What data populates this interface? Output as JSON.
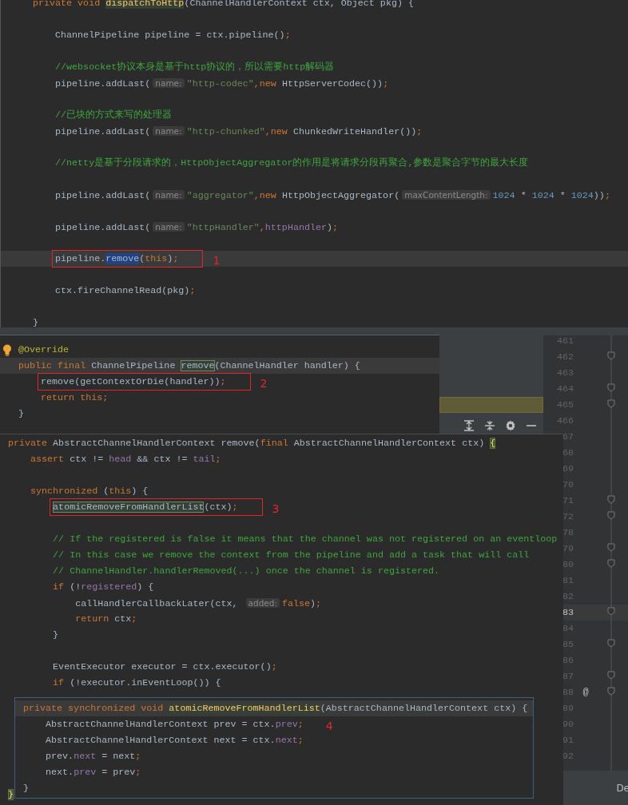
{
  "editors": [
    {
      "kind": "main",
      "lines": [
        {
          "kind": "code",
          "current": false,
          "tokens": [
            {
              "kind": "kw",
              "text": "private void "
            },
            {
              "kind": "decl",
              "text": "dispatchToHttp"
            },
            {
              "kind": "plain",
              "text": "(ChannelHandlerContext ctx, Object pkg) {"
            }
          ]
        },
        {
          "kind": "blank",
          "current": false
        },
        {
          "kind": "code",
          "current": false,
          "tokens": [
            {
              "kind": "plain",
              "text": "    ChannelPipeline pipeline = ctx.pipeline()"
            },
            {
              "kind": "kw",
              "text": ";"
            }
          ]
        },
        {
          "kind": "blank",
          "current": false
        },
        {
          "kind": "code",
          "current": false,
          "tokens": [
            {
              "kind": "comment",
              "text": "    //websocket协议本身是基于http协议的，所以需要http解码器"
            }
          ]
        },
        {
          "kind": "code",
          "current": false,
          "tokens": [
            {
              "kind": "plain",
              "text": "    pipeline.addLast("
            },
            {
              "kind": "hint",
              "text": "name:"
            },
            {
              "kind": "str",
              "text": "\"http-codec\""
            },
            {
              "kind": "kw",
              "text": ",new "
            },
            {
              "kind": "plain",
              "text": "HttpServerCodec())"
            },
            {
              "kind": "kw",
              "text": ";"
            }
          ]
        },
        {
          "kind": "blank",
          "current": false
        },
        {
          "kind": "code",
          "current": false,
          "tokens": [
            {
              "kind": "comment",
              "text": "    //已块的方式来写的处理器"
            }
          ]
        },
        {
          "kind": "code",
          "current": false,
          "tokens": [
            {
              "kind": "plain",
              "text": "    pipeline.addLast("
            },
            {
              "kind": "hint",
              "text": "name:"
            },
            {
              "kind": "str",
              "text": "\"http-chunked\""
            },
            {
              "kind": "kw",
              "text": ",new "
            },
            {
              "kind": "plain",
              "text": "ChunkedWriteHandler())"
            },
            {
              "kind": "kw",
              "text": ";"
            }
          ]
        },
        {
          "kind": "blank",
          "current": false
        },
        {
          "kind": "code",
          "current": false,
          "tokens": [
            {
              "kind": "comment",
              "text": "    //netty是基于分段请求的，HttpObjectAggregator的作用是将请求分段再聚合,参数是聚合字节的最大长度"
            }
          ]
        },
        {
          "kind": "blank",
          "current": false
        },
        {
          "kind": "code",
          "current": false,
          "tokens": [
            {
              "kind": "plain",
              "text": "    pipeline.addLast("
            },
            {
              "kind": "hint",
              "text": "name:"
            },
            {
              "kind": "str",
              "text": "\"aggregator\""
            },
            {
              "kind": "kw",
              "text": ",new "
            },
            {
              "kind": "plain",
              "text": "HttpObjectAggregator("
            },
            {
              "kind": "hint",
              "text": "maxContentLength:"
            },
            {
              "kind": "num",
              "text": "1024"
            },
            {
              "kind": "plain",
              "text": " * "
            },
            {
              "kind": "num",
              "text": "1024"
            },
            {
              "kind": "plain",
              "text": " * "
            },
            {
              "kind": "num",
              "text": "1024"
            },
            {
              "kind": "plain",
              "text": "))"
            },
            {
              "kind": "kw",
              "text": ";"
            }
          ]
        },
        {
          "kind": "blank",
          "current": false
        },
        {
          "kind": "code",
          "current": false,
          "tokens": [
            {
              "kind": "plain",
              "text": "    pipeline.addLast("
            },
            {
              "kind": "hint",
              "text": "name:"
            },
            {
              "kind": "str",
              "text": "\"httpHandler\""
            },
            {
              "kind": "kw",
              "text": ","
            },
            {
              "kind": "field",
              "text": "httpHandler"
            },
            {
              "kind": "plain",
              "text": ")"
            },
            {
              "kind": "kw",
              "text": ";"
            }
          ]
        },
        {
          "kind": "blank",
          "current": false
        },
        {
          "kind": "code",
          "current": true,
          "callout": {
            "label": "1",
            "boxed": true
          },
          "tokens": [
            {
              "kind": "plain",
              "text": "    pipeline."
            },
            {
              "kind": "selected",
              "text": "remove"
            },
            {
              "kind": "plain",
              "text": "("
            },
            {
              "kind": "kw",
              "text": "this"
            },
            {
              "kind": "plain",
              "text": ")"
            },
            {
              "kind": "kw",
              "text": ";"
            }
          ]
        },
        {
          "kind": "blank",
          "current": false
        },
        {
          "kind": "code",
          "current": false,
          "tokens": [
            {
              "kind": "plain",
              "text": "    ctx.fireChannelRead(pkg)"
            },
            {
              "kind": "kw",
              "text": ";"
            }
          ]
        },
        {
          "kind": "blank",
          "current": false
        },
        {
          "kind": "code",
          "current": false,
          "tokens": [
            {
              "kind": "plain",
              "text": "}"
            }
          ]
        }
      ]
    },
    {
      "kind": "popup",
      "lines": [
        {
          "kind": "code",
          "current": false,
          "tokens": [
            {
              "kind": "annotation",
              "text": "@Override"
            }
          ]
        },
        {
          "kind": "code",
          "current": true,
          "tokens": [
            {
              "kind": "kw",
              "text": "public final "
            },
            {
              "kind": "plain",
              "text": "ChannelPipeline "
            },
            {
              "kind": "usage",
              "text": "remove"
            },
            {
              "kind": "plain",
              "text": "(ChannelHandler handler) {"
            }
          ]
        },
        {
          "kind": "code",
          "current": false,
          "callout": {
            "label": "2",
            "boxed": true
          },
          "tokens": [
            {
              "kind": "plain",
              "text": "    remove(getContextOrDie(handler))"
            },
            {
              "kind": "kw",
              "text": ";"
            }
          ]
        },
        {
          "kind": "code",
          "current": false,
          "tokens": [
            {
              "kind": "kw",
              "text": "    return this;"
            }
          ]
        },
        {
          "kind": "code",
          "current": false,
          "tokens": [
            {
              "kind": "plain",
              "text": "}"
            }
          ]
        }
      ]
    },
    {
      "kind": "panel",
      "lines": [
        {
          "kind": "code",
          "current": false,
          "tokens": [
            {
              "kind": "kw",
              "text": "private "
            },
            {
              "kind": "plain",
              "text": "AbstractChannelHandlerContext remove("
            },
            {
              "kind": "kw",
              "text": "final "
            },
            {
              "kind": "plain",
              "text": "AbstractChannelHandlerContext ctx) "
            },
            {
              "kind": "brace",
              "text": "{"
            }
          ]
        },
        {
          "kind": "code",
          "current": false,
          "tokens": [
            {
              "kind": "kw",
              "text": "    assert "
            },
            {
              "kind": "plain",
              "text": "ctx != "
            },
            {
              "kind": "field",
              "text": "head"
            },
            {
              "kind": "plain",
              "text": " && ctx != "
            },
            {
              "kind": "field",
              "text": "tail"
            },
            {
              "kind": "kw",
              "text": ";"
            }
          ]
        },
        {
          "kind": "blank",
          "current": false
        },
        {
          "kind": "code",
          "current": false,
          "tokens": [
            {
              "kind": "kw",
              "text": "    synchronized "
            },
            {
              "kind": "plain",
              "text": "("
            },
            {
              "kind": "kw",
              "text": "this"
            },
            {
              "kind": "plain",
              "text": ") {"
            }
          ]
        },
        {
          "kind": "code",
          "current": false,
          "callout": {
            "label": "3",
            "boxed": true
          },
          "tokens": [
            {
              "kind": "usage",
              "text": "        atomicRemoveFromHandlerList"
            },
            {
              "kind": "plain",
              "text": "(ctx)"
            },
            {
              "kind": "kw",
              "text": ";"
            }
          ]
        },
        {
          "kind": "blank",
          "current": false
        },
        {
          "kind": "code",
          "current": false,
          "tokens": [
            {
              "kind": "comment",
              "text": "        // If the registered is false it means that the channel was not registered on an eventloop"
            }
          ]
        },
        {
          "kind": "code",
          "current": false,
          "tokens": [
            {
              "kind": "comment",
              "text": "        // In this case we remove the context from the pipeline and add a task that will call"
            }
          ]
        },
        {
          "kind": "code",
          "current": false,
          "tokens": [
            {
              "kind": "comment",
              "text": "        // ChannelHandler.handlerRemoved(...) once the channel is registered."
            }
          ]
        },
        {
          "kind": "code",
          "current": false,
          "tokens": [
            {
              "kind": "kw",
              "text": "        if "
            },
            {
              "kind": "plain",
              "text": "(!"
            },
            {
              "kind": "field",
              "text": "registered"
            },
            {
              "kind": "plain",
              "text": ") {"
            }
          ]
        },
        {
          "kind": "code",
          "current": false,
          "tokens": [
            {
              "kind": "plain",
              "text": "            callHandlerCallbackLater(ctx, "
            },
            {
              "kind": "hint",
              "text": "added:"
            },
            {
              "kind": "kw",
              "text": "false"
            },
            {
              "kind": "plain",
              "text": ")"
            },
            {
              "kind": "kw",
              "text": ";"
            }
          ]
        },
        {
          "kind": "code",
          "current": false,
          "tokens": [
            {
              "kind": "kw",
              "text": "            return "
            },
            {
              "kind": "plain",
              "text": "ctx"
            },
            {
              "kind": "kw",
              "text": ";"
            }
          ]
        },
        {
          "kind": "code",
          "current": false,
          "tokens": [
            {
              "kind": "plain",
              "text": "        }"
            }
          ]
        },
        {
          "kind": "blank",
          "current": false
        },
        {
          "kind": "code",
          "current": false,
          "tokens": [
            {
              "kind": "plain",
              "text": "        EventExecutor executor = ctx.executor()"
            },
            {
              "kind": "kw",
              "text": ";"
            }
          ]
        },
        {
          "kind": "code",
          "current": false,
          "tokens": [
            {
              "kind": "kw",
              "text": "        if "
            },
            {
              "kind": "plain",
              "text": "(!executor.inEventLoop()) {"
            }
          ]
        },
        {
          "kind": "blank",
          "current": false
        },
        {
          "kind": "blank",
          "current": false
        },
        {
          "kind": "blank",
          "current": false
        },
        {
          "kind": "blank",
          "current": false
        },
        {
          "kind": "blank",
          "current": false
        },
        {
          "kind": "blank",
          "current": false
        },
        {
          "kind": "code",
          "current": false,
          "tokens": [
            {
              "kind": "brace",
              "text": "}"
            }
          ]
        }
      ]
    },
    {
      "kind": "tooltip",
      "lines": [
        {
          "kind": "code",
          "current": true,
          "tokens": [
            {
              "kind": "kw",
              "text": "private synchronized void "
            },
            {
              "kind": "decl",
              "text": "atomicRemoveFromHandlerList"
            },
            {
              "kind": "plain",
              "text": "(AbstractChannelHandlerContext ctx) {"
            }
          ]
        },
        {
          "kind": "code",
          "current": false,
          "callout": {
            "label": "4",
            "boxed": false
          },
          "tokens": [
            {
              "kind": "plain",
              "text": "    AbstractChannelHandlerContext prev = ctx."
            },
            {
              "kind": "field",
              "text": "prev"
            },
            {
              "kind": "kw",
              "text": ";"
            }
          ]
        },
        {
          "kind": "code",
          "current": false,
          "tokens": [
            {
              "kind": "plain",
              "text": "    AbstractChannelHandlerContext next = ctx."
            },
            {
              "kind": "field",
              "text": "next"
            },
            {
              "kind": "kw",
              "text": ";"
            }
          ]
        },
        {
          "kind": "code",
          "current": false,
          "tokens": [
            {
              "kind": "plain",
              "text": "    prev."
            },
            {
              "kind": "field",
              "text": "next"
            },
            {
              "kind": "plain",
              "text": " = next"
            },
            {
              "kind": "kw",
              "text": ";"
            }
          ]
        },
        {
          "kind": "code",
          "current": false,
          "tokens": [
            {
              "kind": "plain",
              "text": "    next."
            },
            {
              "kind": "field",
              "text": "prev"
            },
            {
              "kind": "plain",
              "text": " = prev"
            },
            {
              "kind": "kw",
              "text": ";"
            }
          ]
        },
        {
          "kind": "code",
          "current": false,
          "tokens": [
            {
              "kind": "plain",
              "text": "}"
            }
          ]
        }
      ]
    }
  ],
  "side_panel": {
    "top_line_numbers": [
      {
        "text": "461",
        "search_match": false,
        "caret": false
      },
      {
        "text": "462",
        "search_match": false,
        "caret": false
      },
      {
        "text": "463",
        "search_match": false,
        "caret": false
      },
      {
        "text": "464",
        "search_match": false,
        "caret": false
      },
      {
        "text": "465",
        "search_match": true,
        "caret": false
      },
      {
        "text": "466",
        "search_match": false,
        "caret": false
      }
    ],
    "line_numbers": [
      {
        "text": "67",
        "caret": false
      },
      {
        "text": "68",
        "caret": false
      },
      {
        "text": "69",
        "caret": false
      },
      {
        "text": "70",
        "caret": false
      },
      {
        "text": "71",
        "caret": false
      },
      {
        "text": "72",
        "caret": false
      },
      {
        "text": "78",
        "caret": false
      },
      {
        "text": "79",
        "caret": false
      },
      {
        "text": "80",
        "caret": false
      },
      {
        "text": "81",
        "caret": false
      },
      {
        "text": "82",
        "caret": false
      },
      {
        "text": "83",
        "caret": true
      },
      {
        "text": "84",
        "caret": false
      },
      {
        "text": "85",
        "caret": false
      },
      {
        "text": "86",
        "caret": false
      },
      {
        "text": "87",
        "caret": false
      },
      {
        "text": "88",
        "caret": false,
        "gutter_mark": "@"
      },
      {
        "text": "89",
        "caret": false
      },
      {
        "text": "90",
        "caret": false
      },
      {
        "text": "91",
        "caret": false
      },
      {
        "text": "92",
        "caret": false
      }
    ],
    "tab": "De"
  }
}
